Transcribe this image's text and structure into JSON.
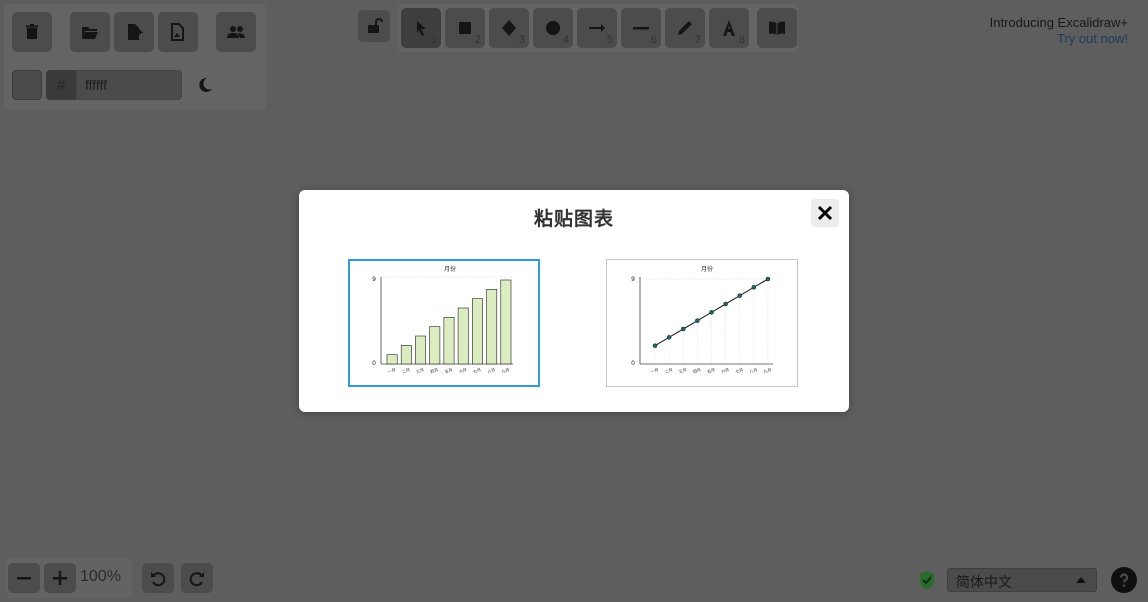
{
  "toolbar_left": {
    "hex_hash": "#",
    "hex_value": "ffffff"
  },
  "tools": [
    {
      "name": "selection",
      "num": "1"
    },
    {
      "name": "rectangle",
      "num": "2"
    },
    {
      "name": "diamond",
      "num": "3"
    },
    {
      "name": "ellipse",
      "num": "4"
    },
    {
      "name": "arrow",
      "num": "5"
    },
    {
      "name": "line",
      "num": "6"
    },
    {
      "name": "draw",
      "num": "7"
    },
    {
      "name": "text",
      "num": "8"
    }
  ],
  "promo": {
    "line1": "Introducing Excalidraw+",
    "line2": "Try out now!"
  },
  "modal": {
    "title": "粘贴图表",
    "bar_chart_title": "月份",
    "line_chart_title": "月份"
  },
  "footer": {
    "zoom": "100%",
    "language": "简体中文"
  },
  "chart_data": [
    {
      "type": "bar",
      "title": "月份",
      "categories": [
        "一月",
        "二月",
        "三月",
        "四月",
        "五月",
        "六月",
        "七月",
        "八月",
        "九月"
      ],
      "values": [
        1,
        2,
        3,
        4,
        5,
        6,
        7,
        8,
        9
      ],
      "ylim": [
        0,
        9
      ],
      "y_ticks": [
        "0",
        "9"
      ],
      "color": "#dbedc0",
      "stroke": "#222222",
      "grid": true
    },
    {
      "type": "line",
      "title": "月份",
      "categories": [
        "一月",
        "二月",
        "三月",
        "四月",
        "五月",
        "六月",
        "七月",
        "八月",
        "九月"
      ],
      "values": [
        1,
        2,
        3,
        4,
        5,
        6,
        7,
        8,
        9
      ],
      "ylim": [
        0,
        9
      ],
      "y_ticks": [
        "0",
        "9"
      ],
      "color": "#222222",
      "marker_color": "#1a6b6b",
      "grid": true
    }
  ],
  "colors": {
    "overlay": "#000000a0",
    "selected_border": "#2f9bd8",
    "security_icon": "#2a6a2a"
  }
}
